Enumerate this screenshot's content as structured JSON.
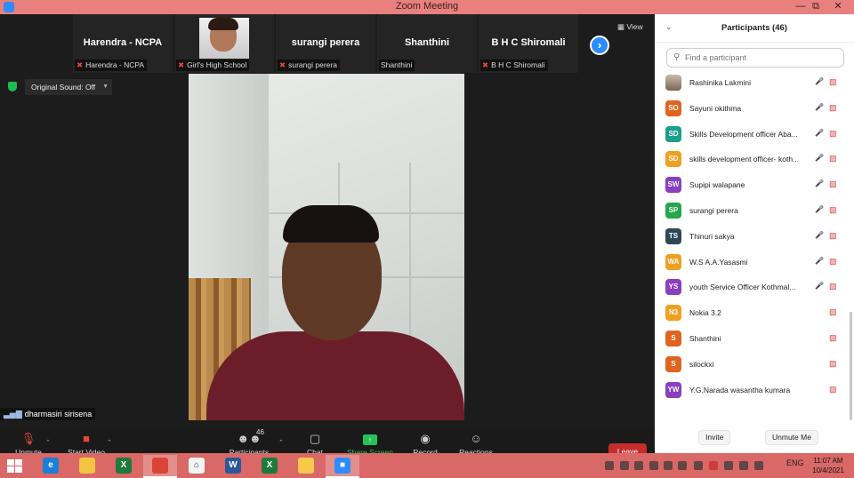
{
  "window": {
    "title": "Zoom Meeting"
  },
  "gallery": {
    "thumbnails": [
      {
        "name": "Harendra - NCPA",
        "label": "Harendra - NCPA",
        "muted": true,
        "video": false
      },
      {
        "name": "",
        "label": "Girl's High School",
        "muted": true,
        "video": true
      },
      {
        "name": "surangi perera",
        "label": "surangi perera",
        "muted": true,
        "video": false
      },
      {
        "name": "Shanthini",
        "label": "Shanthini",
        "muted": false,
        "video": false
      },
      {
        "name": "B H C Shiromali",
        "label": "B H C Shiromali",
        "muted": true,
        "video": false
      }
    ],
    "view_label": "View"
  },
  "audio": {
    "original_sound": "Original Sound: Off"
  },
  "active_speaker": {
    "name": "dharmasiri sirisena"
  },
  "controls": {
    "unmute": "Unmute",
    "start_video": "Start Video",
    "participants": "Participants",
    "participants_count": "46",
    "chat": "Chat",
    "share_screen": "Share Screen",
    "record": "Record",
    "reactions": "Reactions",
    "leave": "Leave"
  },
  "panel": {
    "title": "Participants (46)",
    "search_placeholder": "Find a participant",
    "participants": [
      {
        "initials": "",
        "name": "Rashinika Lakmini",
        "color": "",
        "mic_off": true
      },
      {
        "initials": "SO",
        "name": "Sayuni okithma",
        "color": "#e0641f",
        "mic_off": true
      },
      {
        "initials": "SD",
        "name": "Skills Development  officer  Aba...",
        "color": "#1e9e8c",
        "mic_off": true
      },
      {
        "initials": "SD",
        "name": "skills development officer- koth...",
        "color": "#f0a020",
        "mic_off": true
      },
      {
        "initials": "SW",
        "name": "Supipi walapane",
        "color": "#8a3fc0",
        "mic_off": true
      },
      {
        "initials": "SP",
        "name": "surangi perera",
        "color": "#24a849",
        "mic_off": true
      },
      {
        "initials": "TS",
        "name": "Thinuri sakya",
        "color": "#2f4858",
        "mic_off": true
      },
      {
        "initials": "WA",
        "name": "W.S A.A.Yasasmi",
        "color": "#f0a020",
        "mic_off": true
      },
      {
        "initials": "YS",
        "name": "youth  Service  Officer  Kothmal...",
        "color": "#8a3fc0",
        "mic_off": true
      },
      {
        "initials": "N3",
        "name": "Nokia 3.2",
        "color": "#f0a020",
        "mic_off": false
      },
      {
        "initials": "S",
        "name": "Shanthini",
        "color": "#e0641f",
        "mic_off": false
      },
      {
        "initials": "S",
        "name": "silockxi",
        "color": "#e0641f",
        "mic_off": false
      },
      {
        "initials": "YW",
        "name": "Y.G.Narada wasantha kumara",
        "color": "#8a3fc0",
        "mic_off": false
      }
    ],
    "invite": "Invite",
    "unmute_me": "Unmute Me"
  },
  "taskbar": {
    "apps": [
      {
        "name": "internet-explorer-icon",
        "glyph": "e",
        "color": "#1b7fd6"
      },
      {
        "name": "file-explorer-icon",
        "glyph": "",
        "color": "#f4c542"
      },
      {
        "name": "excel-icon",
        "glyph": "X",
        "color": "#1e7a3c"
      },
      {
        "name": "chrome-icon",
        "glyph": "",
        "color": "#db4437"
      },
      {
        "name": "home-icon",
        "glyph": "⌂",
        "color": "#f5f5f5"
      },
      {
        "name": "word-icon",
        "glyph": "W",
        "color": "#2b5797"
      },
      {
        "name": "excel-icon",
        "glyph": "X",
        "color": "#1e7a3c"
      },
      {
        "name": "sticky-notes-icon",
        "glyph": "",
        "color": "#f6c94a"
      },
      {
        "name": "zoom-icon",
        "glyph": "■",
        "color": "#2d8cff"
      }
    ],
    "language": "ENG",
    "time": "11:07 AM",
    "date": "10/4/2021"
  }
}
